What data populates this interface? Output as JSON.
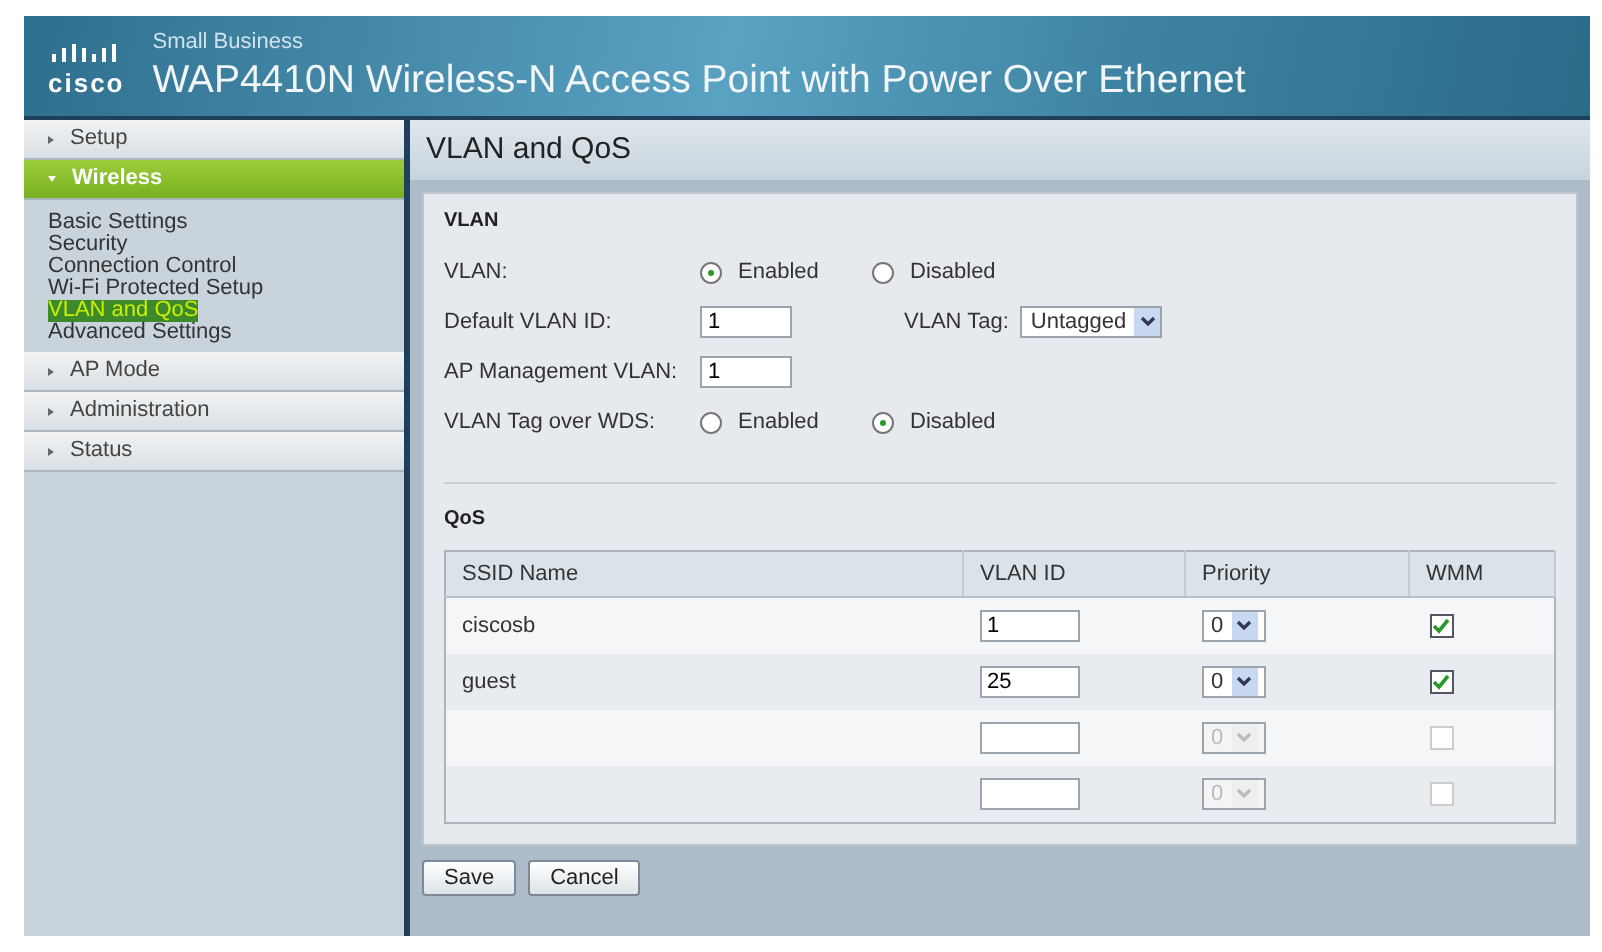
{
  "header": {
    "brand": "cisco",
    "subtitle": "Small Business",
    "title": "WAP4410N Wireless-N Access Point with Power Over Ethernet"
  },
  "sidebar": {
    "groups": [
      {
        "label": "Setup",
        "expanded": false,
        "selected": false
      },
      {
        "label": "Wireless",
        "expanded": true,
        "selected": true,
        "items": [
          {
            "label": "Basic Settings",
            "selected": false
          },
          {
            "label": "Security",
            "selected": false
          },
          {
            "label": "Connection Control",
            "selected": false
          },
          {
            "label": "Wi-Fi Protected Setup",
            "selected": false
          },
          {
            "label": "VLAN and QoS",
            "selected": true
          },
          {
            "label": "Advanced Settings",
            "selected": false
          }
        ]
      },
      {
        "label": "AP Mode",
        "expanded": false,
        "selected": false
      },
      {
        "label": "Administration",
        "expanded": false,
        "selected": false
      },
      {
        "label": "Status",
        "expanded": false,
        "selected": false
      }
    ]
  },
  "page_title": "VLAN and QoS",
  "vlan": {
    "heading": "VLAN",
    "rows": [
      {
        "kind": "radio",
        "label": "VLAN:",
        "options": [
          {
            "label": "Enabled",
            "selected": true
          },
          {
            "label": "Disabled",
            "selected": false
          }
        ]
      },
      {
        "kind": "text_select",
        "label": "Default VLAN ID:",
        "value": "1",
        "select_label": "VLAN Tag:",
        "select_value": "Untagged"
      },
      {
        "kind": "text",
        "label": "AP Management VLAN:",
        "value": "1"
      },
      {
        "kind": "radio",
        "label": "VLAN Tag over WDS:",
        "options": [
          {
            "label": "Enabled",
            "selected": false
          },
          {
            "label": "Disabled",
            "selected": true
          }
        ]
      }
    ]
  },
  "qos": {
    "heading": "QoS",
    "columns": [
      "SSID Name",
      "VLAN ID",
      "Priority",
      "WMM"
    ],
    "rows": [
      {
        "ssid": "ciscosb",
        "vlan_id": "1",
        "priority": "0",
        "wmm": true,
        "disabled": false
      },
      {
        "ssid": "guest",
        "vlan_id": "25",
        "priority": "0",
        "wmm": true,
        "disabled": false
      },
      {
        "priority": "0",
        "wmm": false,
        "disabled": true
      },
      {
        "priority": "0",
        "wmm": false,
        "disabled": true
      }
    ]
  },
  "buttons": [
    "Save",
    "Cancel"
  ]
}
